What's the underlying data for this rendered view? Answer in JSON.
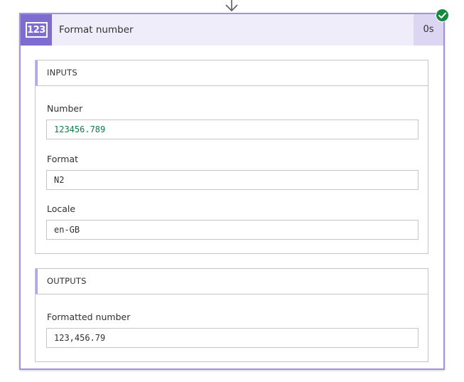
{
  "action": {
    "icon_label": "123",
    "title": "Format number",
    "duration": "0s",
    "status": "succeeded",
    "colors": {
      "accent": "#7f6cd0",
      "header_bg": "#efedfa",
      "success": "#148a3e"
    }
  },
  "inputs": {
    "heading": "INPUTS",
    "fields": [
      {
        "label": "Number",
        "value": "123456.789"
      },
      {
        "label": "Format",
        "value": "N2"
      },
      {
        "label": "Locale",
        "value": "en-GB"
      }
    ]
  },
  "outputs": {
    "heading": "OUTPUTS",
    "fields": [
      {
        "label": "Formatted number",
        "value": "123,456.79"
      }
    ]
  },
  "icons": {
    "connector": "down-arrow-icon",
    "status": "check-circle-icon",
    "action": "number-format-icon"
  }
}
